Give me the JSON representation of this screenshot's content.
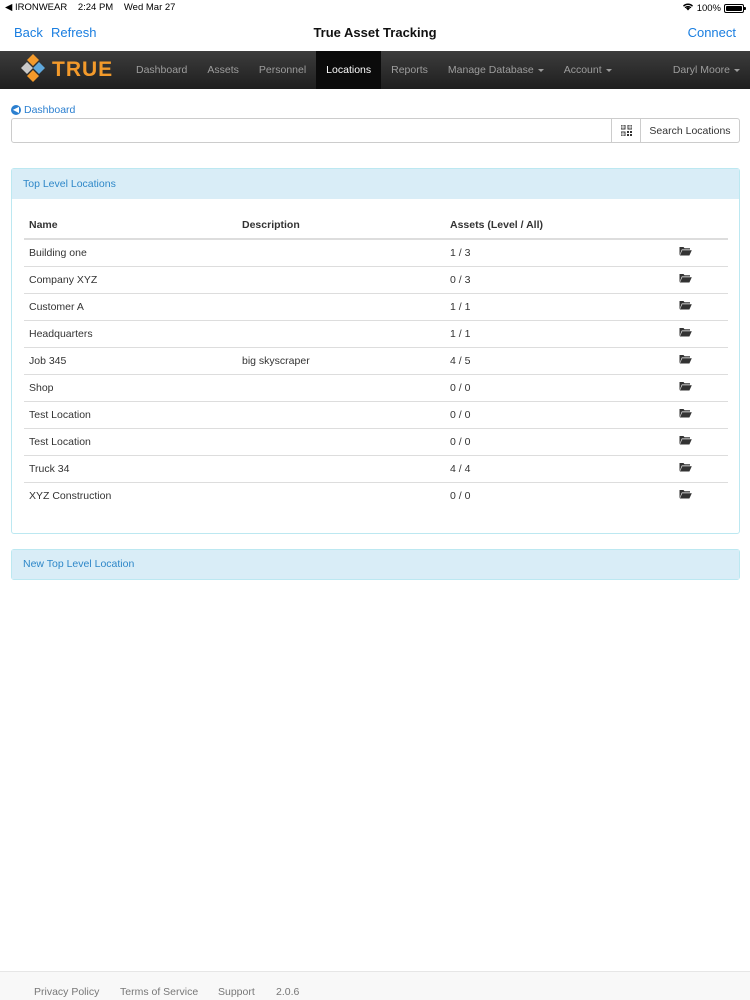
{
  "status_bar": {
    "carrier": "◀ IRONWEAR",
    "time": "2:24 PM",
    "date": "Wed Mar 27",
    "battery": "100%"
  },
  "app_bar": {
    "back": "Back",
    "refresh": "Refresh",
    "title": "True Asset Tracking",
    "connect": "Connect"
  },
  "navbar": {
    "brand": "TRUE",
    "links": [
      "Dashboard",
      "Assets",
      "Personnel",
      "Locations",
      "Reports",
      "Manage Database",
      "Account"
    ],
    "user": "Daryl Moore"
  },
  "breadcrumb": "Dashboard",
  "search": {
    "value": "",
    "button": "Search Locations"
  },
  "locations_panel": {
    "title": "Top Level Locations",
    "columns": [
      "Name",
      "Description",
      "Assets (Level / All)"
    ],
    "rows": [
      {
        "name": "Building one",
        "description": "",
        "assets": "1 / 3"
      },
      {
        "name": "Company XYZ",
        "description": "",
        "assets": "0 / 3"
      },
      {
        "name": "Customer A",
        "description": "",
        "assets": "1 / 1"
      },
      {
        "name": "Headquarters",
        "description": "",
        "assets": "1 / 1"
      },
      {
        "name": "Job 345",
        "description": "big skyscraper",
        "assets": "4 / 5"
      },
      {
        "name": "Shop",
        "description": "",
        "assets": "0 / 0"
      },
      {
        "name": "Test Location",
        "description": "",
        "assets": "0 / 0"
      },
      {
        "name": "Test Location",
        "description": "",
        "assets": "0 / 0"
      },
      {
        "name": "Truck 34",
        "description": "",
        "assets": "4 / 4"
      },
      {
        "name": "XYZ Construction",
        "description": "",
        "assets": "0 / 0"
      }
    ]
  },
  "new_location_panel": {
    "title": "New Top Level Location"
  },
  "footer": {
    "privacy": "Privacy Policy",
    "terms": "Terms of Service",
    "support": "Support",
    "version": "2.0.6"
  },
  "colors": {
    "link_blue": "#1a7ee0",
    "brand_orange": "#f39a2b",
    "panel_heading_bg": "#d9edf7",
    "panel_heading_text": "#2e87c8",
    "navbar_dark": "#222222"
  }
}
